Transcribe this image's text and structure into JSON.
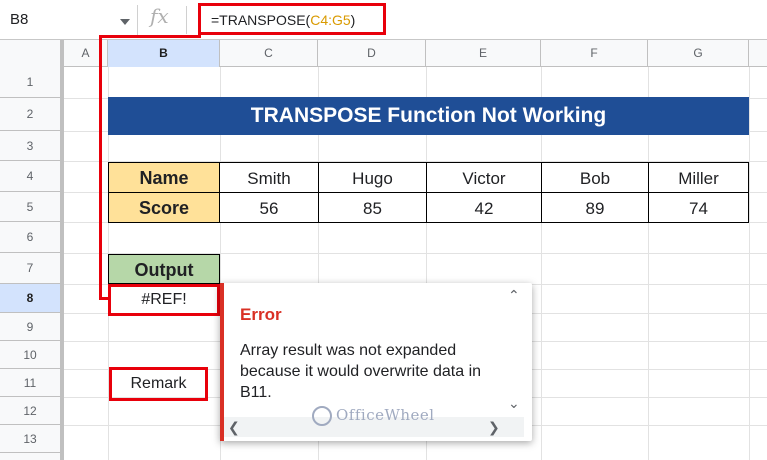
{
  "formula_bar": {
    "name_box": "B8",
    "fx_label": "fx",
    "formula_prefix": "=TRANSPOSE(",
    "formula_range": "C4:G5",
    "formula_suffix": ")"
  },
  "columns": [
    "A",
    "B",
    "C",
    "D",
    "E",
    "F",
    "G"
  ],
  "rows": [
    "1",
    "2",
    "3",
    "4",
    "5",
    "6",
    "7",
    "8",
    "9",
    "10",
    "11",
    "12",
    "13"
  ],
  "sheet": {
    "title": "TRANSPOSE Function Not Working",
    "table": {
      "name_label": "Name",
      "score_label": "Score",
      "names": [
        "Smith",
        "Hugo",
        "Victor",
        "Bob",
        "Miller"
      ],
      "scores": [
        "56",
        "85",
        "42",
        "89",
        "74"
      ]
    },
    "output_label": "Output",
    "output_value": "#REF!",
    "remark_value": "Remark"
  },
  "error_popup": {
    "title": "Error",
    "message": "Array result was not expanded because it would overwrite data in B11."
  },
  "watermark": "OfficeWheel",
  "colors": {
    "title_bg": "#1f4e96",
    "header_bg": "#ffe199",
    "output_bg": "#b6d7a8",
    "highlight": "#e8000b",
    "error": "#d93025"
  }
}
